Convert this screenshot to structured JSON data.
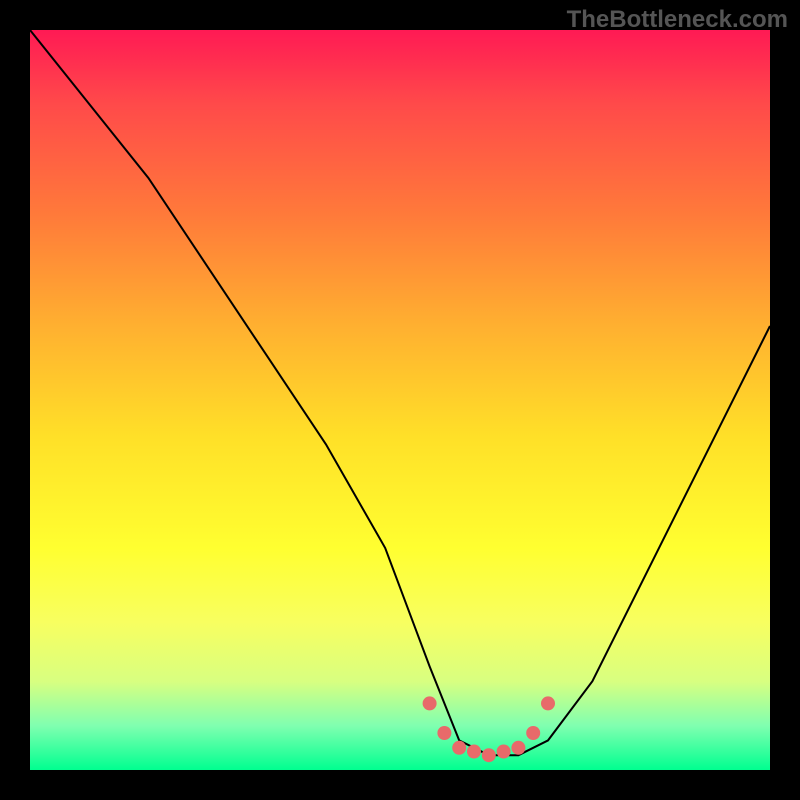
{
  "watermark": "TheBottleneck.com",
  "chart_data": {
    "type": "line",
    "title": "",
    "xlabel": "",
    "ylabel": "",
    "xlim": [
      0,
      100
    ],
    "ylim": [
      0,
      100
    ],
    "series": [
      {
        "name": "curve",
        "x": [
          0,
          8,
          16,
          24,
          32,
          40,
          48,
          54,
          58,
          62,
          66,
          70,
          76,
          84,
          92,
          100
        ],
        "values": [
          100,
          90,
          80,
          68,
          56,
          44,
          30,
          14,
          4,
          2,
          2,
          4,
          12,
          28,
          44,
          60
        ]
      }
    ],
    "markers": {
      "name": "highlight-dots",
      "color": "#e86a6a",
      "x": [
        54,
        56,
        58,
        60,
        62,
        64,
        66,
        68,
        70
      ],
      "values": [
        9,
        5,
        3,
        2.5,
        2,
        2.5,
        3,
        5,
        9
      ]
    },
    "gradient_stops": [
      {
        "pos": 0,
        "color": "#ff1a54"
      },
      {
        "pos": 50,
        "color": "#ffe028"
      },
      {
        "pos": 100,
        "color": "#00ff90"
      }
    ]
  }
}
